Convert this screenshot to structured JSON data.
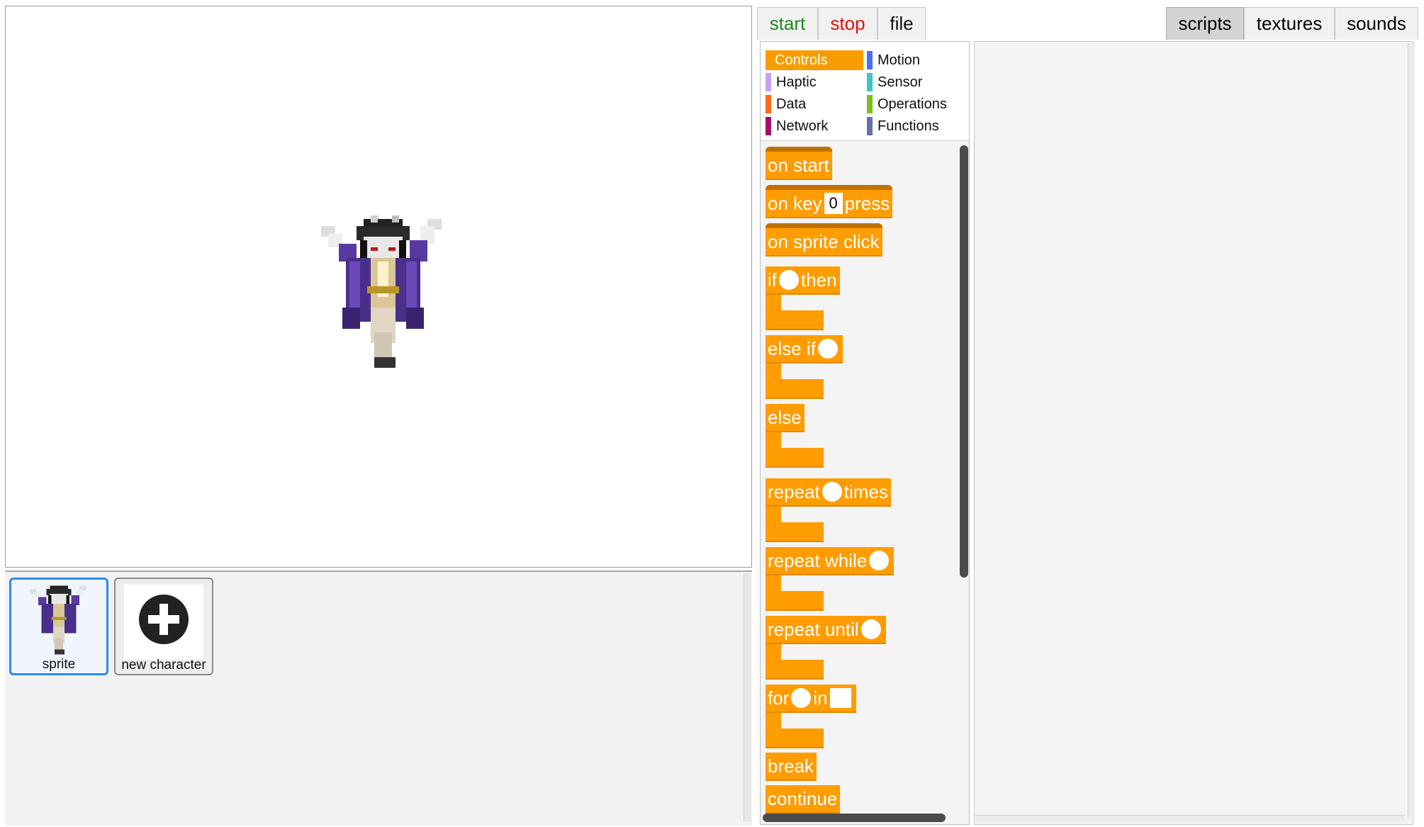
{
  "toolbar": {
    "start": "start",
    "stop": "stop",
    "file": "file"
  },
  "tabs": {
    "scripts": "scripts",
    "textures": "textures",
    "sounds": "sounds",
    "active": "scripts"
  },
  "categories": [
    {
      "label": "Controls",
      "color": "#f99c00",
      "active": true
    },
    {
      "label": "Motion",
      "color": "#4a6cf0"
    },
    {
      "label": "Haptic",
      "color": "#c9a0f5"
    },
    {
      "label": "Sensor",
      "color": "#3dc6c6"
    },
    {
      "label": "Data",
      "color": "#f86a17"
    },
    {
      "label": "Operations",
      "color": "#7cbf1c"
    },
    {
      "label": "Network",
      "color": "#a0126b"
    },
    {
      "label": "Functions",
      "color": "#6c6ca8"
    }
  ],
  "blocks": {
    "on_start": "on start",
    "on_key": "on key",
    "on_key_value": "0",
    "on_key_press": "press",
    "on_sprite_click": "on sprite click",
    "if": "if",
    "then": "then",
    "else_if": "else if",
    "else": "else",
    "repeat": "repeat",
    "times": "times",
    "repeat_while": "repeat while",
    "repeat_until": "repeat until",
    "for": "for",
    "in": "in",
    "break": "break",
    "continue": "continue"
  },
  "sprites": [
    {
      "label": "sprite",
      "selected": true
    },
    {
      "label": "new character",
      "icon": "plus-circle-icon"
    }
  ]
}
